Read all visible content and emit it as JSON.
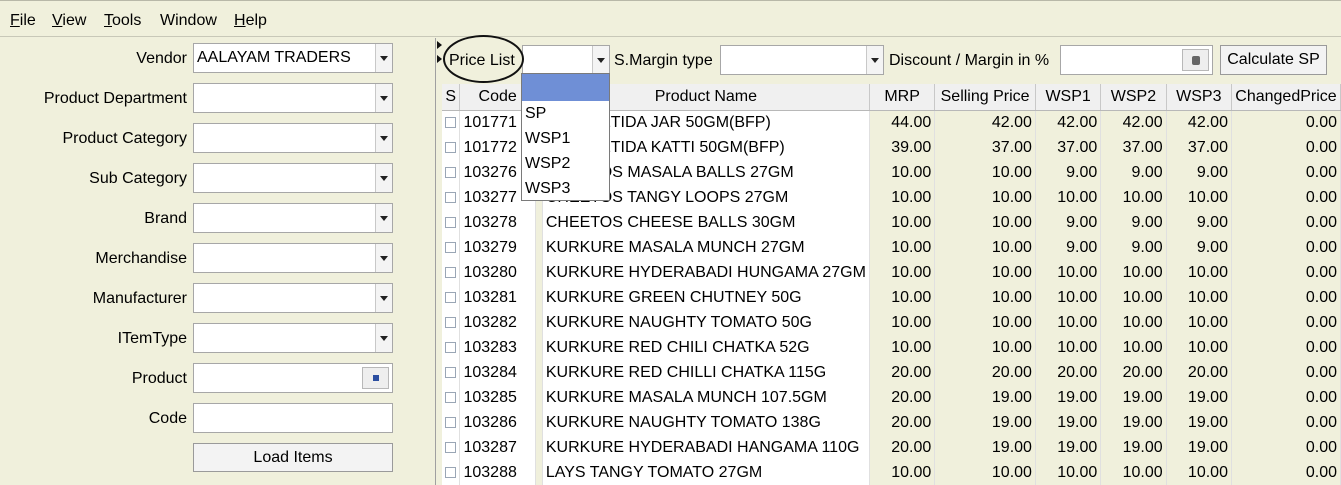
{
  "menu": {
    "items": [
      {
        "label": "File",
        "underline": "F",
        "rest": "ile"
      },
      {
        "label": "View",
        "underline": "V",
        "rest": "iew"
      },
      {
        "label": "Tools",
        "underline": "T",
        "rest": "ools"
      },
      {
        "label": "Window",
        "underline": "",
        "rest": "Window"
      },
      {
        "label": "Help",
        "underline": "H",
        "rest": "elp"
      }
    ]
  },
  "filters": {
    "vendor_label": "Vendor",
    "vendor_value": "AALAYAM TRADERS",
    "department_label": "Product Department",
    "category_label": "Product Category",
    "subcategory_label": "Sub Category",
    "brand_label": "Brand",
    "merchandise_label": "Merchandise",
    "manufacturer_label": "Manufacturer",
    "itemtype_label": "ITemType",
    "product_label": "Product",
    "code_label": "Code",
    "load_button": "Load Items"
  },
  "toolbar": {
    "price_list_label": "Price List",
    "margin_type_label": "S.Margin type",
    "discount_label": "Discount / Margin in %",
    "calculate_button": "Calculate SP"
  },
  "price_list_dropdown": {
    "options": [
      "",
      "SP",
      "WSP1",
      "WSP2",
      "WSP3"
    ],
    "highlighted_index": 0
  },
  "grid": {
    "columns": [
      "S",
      "Code",
      "",
      "Product Name",
      "MRP",
      "Selling Price",
      "WSP1",
      "WSP2",
      "WSP3",
      "ChangedPrice"
    ],
    "rows": [
      {
        "code": "101771",
        "name": "ASAFOETIDA JAR 50GM(BFP)",
        "mrp": "44.00",
        "sp": "42.00",
        "wsp1": "42.00",
        "wsp2": "42.00",
        "wsp3": "42.00",
        "changed": "0.00"
      },
      {
        "code": "101772",
        "name": "ASAFOETIDA KATTI 50GM(BFP)",
        "mrp": "39.00",
        "sp": "37.00",
        "wsp1": "37.00",
        "wsp2": "37.00",
        "wsp3": "37.00",
        "changed": "0.00"
      },
      {
        "code": "103276",
        "name": "CHEETOS MASALA BALLS 27GM",
        "mrp": "10.00",
        "sp": "10.00",
        "wsp1": "9.00",
        "wsp2": "9.00",
        "wsp3": "9.00",
        "changed": "0.00"
      },
      {
        "code": "103277",
        "name": "CHEETOS TANGY LOOPS 27GM",
        "mrp": "10.00",
        "sp": "10.00",
        "wsp1": "10.00",
        "wsp2": "10.00",
        "wsp3": "10.00",
        "changed": "0.00"
      },
      {
        "code": "103278",
        "name": "CHEETOS CHEESE BALLS 30GM",
        "mrp": "10.00",
        "sp": "10.00",
        "wsp1": "9.00",
        "wsp2": "9.00",
        "wsp3": "9.00",
        "changed": "0.00"
      },
      {
        "code": "103279",
        "name": "KURKURE MASALA MUNCH 27GM",
        "mrp": "10.00",
        "sp": "10.00",
        "wsp1": "9.00",
        "wsp2": "9.00",
        "wsp3": "9.00",
        "changed": "0.00"
      },
      {
        "code": "103280",
        "name": "KURKURE HYDERABADI HUNGAMA 27GM",
        "mrp": "10.00",
        "sp": "10.00",
        "wsp1": "10.00",
        "wsp2": "10.00",
        "wsp3": "10.00",
        "changed": "0.00"
      },
      {
        "code": "103281",
        "name": "KURKURE GREEN CHUTNEY 50G",
        "mrp": "10.00",
        "sp": "10.00",
        "wsp1": "10.00",
        "wsp2": "10.00",
        "wsp3": "10.00",
        "changed": "0.00"
      },
      {
        "code": "103282",
        "name": "KURKURE NAUGHTY TOMATO 50G",
        "mrp": "10.00",
        "sp": "10.00",
        "wsp1": "10.00",
        "wsp2": "10.00",
        "wsp3": "10.00",
        "changed": "0.00"
      },
      {
        "code": "103283",
        "name": "KURKURE RED CHILI CHATKA 52G",
        "mrp": "10.00",
        "sp": "10.00",
        "wsp1": "10.00",
        "wsp2": "10.00",
        "wsp3": "10.00",
        "changed": "0.00"
      },
      {
        "code": "103284",
        "name": "KURKURE RED CHILLI CHATKA 115G",
        "mrp": "20.00",
        "sp": "20.00",
        "wsp1": "20.00",
        "wsp2": "20.00",
        "wsp3": "20.00",
        "changed": "0.00"
      },
      {
        "code": "103285",
        "name": "KURKURE MASALA MUNCH 107.5GM",
        "mrp": "20.00",
        "sp": "19.00",
        "wsp1": "19.00",
        "wsp2": "19.00",
        "wsp3": "19.00",
        "changed": "0.00"
      },
      {
        "code": "103286",
        "name": "KURKURE NAUGHTY TOMATO 138G",
        "mrp": "20.00",
        "sp": "19.00",
        "wsp1": "19.00",
        "wsp2": "19.00",
        "wsp3": "19.00",
        "changed": "0.00"
      },
      {
        "code": "103287",
        "name": "KURKURE HYDERABADI HANGAMA 110G",
        "mrp": "20.00",
        "sp": "19.00",
        "wsp1": "19.00",
        "wsp2": "19.00",
        "wsp3": "19.00",
        "changed": "0.00"
      },
      {
        "code": "103288",
        "name": "LAYS TANGY TOMATO 27GM",
        "mrp": "10.00",
        "sp": "10.00",
        "wsp1": "10.00",
        "wsp2": "10.00",
        "wsp3": "10.00",
        "changed": "0.00"
      }
    ]
  }
}
